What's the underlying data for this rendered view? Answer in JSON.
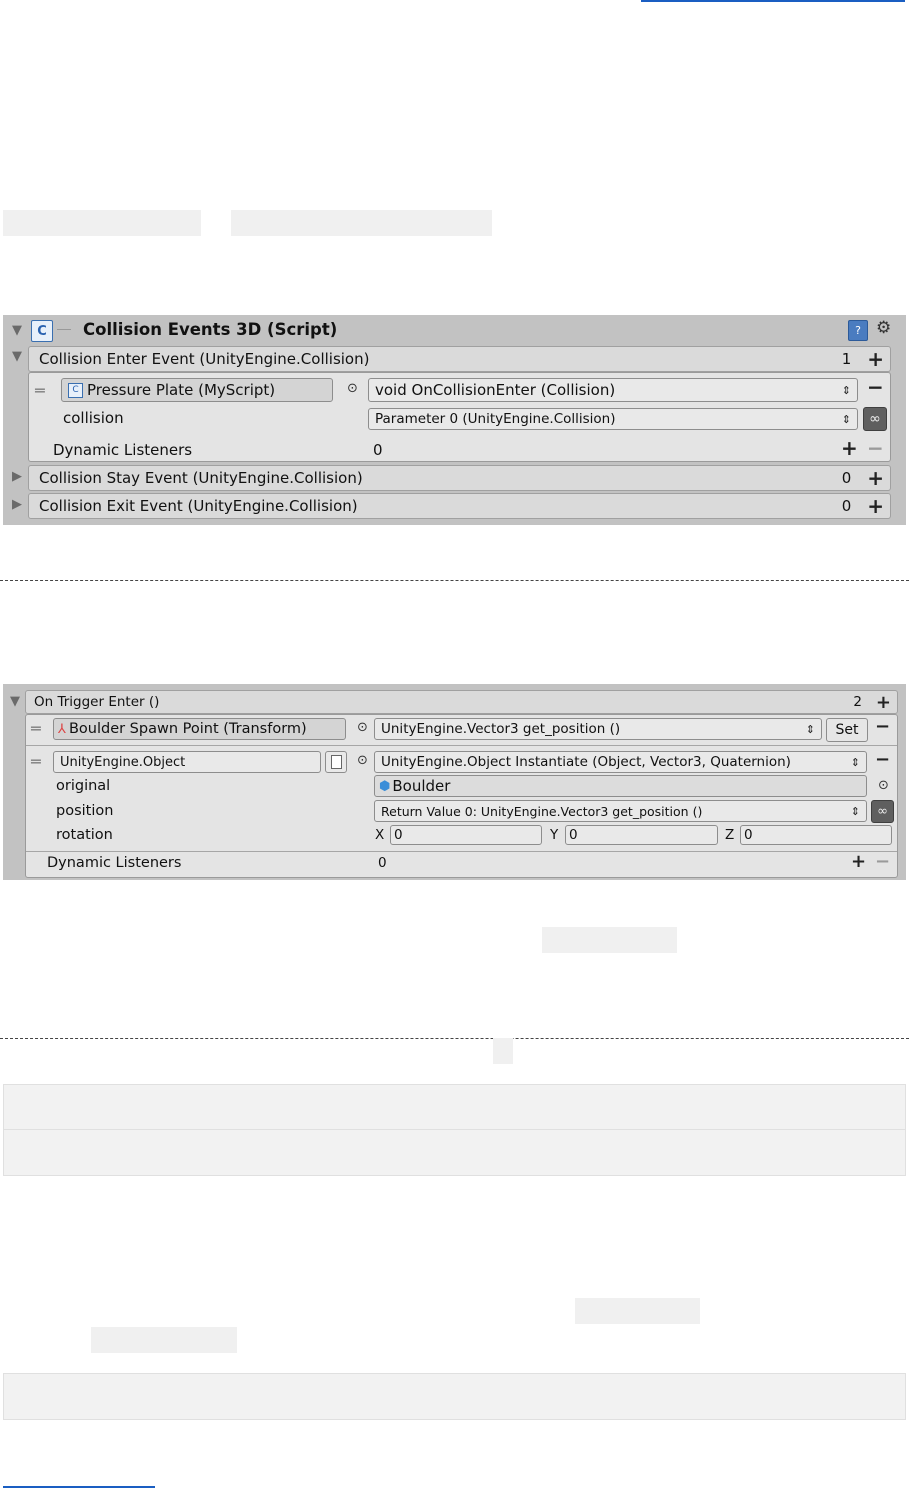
{
  "panel1": {
    "title": "Collision Events 3D (Script)",
    "enter_event": {
      "label": "Collision Enter Event (UnityEngine.Collision)",
      "count": "1"
    },
    "row": {
      "target": "Pressure Plate (MyScript)",
      "function": "void OnCollisionEnter (Collision)",
      "param_label": "collision",
      "param_value": "Parameter 0 (UnityEngine.Collision)"
    },
    "dynamic": {
      "label": "Dynamic Listeners",
      "count": "0"
    },
    "stay_event": {
      "label": "Collision Stay Event (UnityEngine.Collision)",
      "count": "0"
    },
    "exit_event": {
      "label": "Collision Exit Event (UnityEngine.Collision)",
      "count": "0"
    }
  },
  "panel2": {
    "header": {
      "label": "On Trigger Enter ()",
      "count": "2"
    },
    "row1": {
      "target": "Boulder Spawn Point (Transform)",
      "function": "UnityEngine.Vector3 get_position ()",
      "set_label": "Set"
    },
    "row2": {
      "target": "UnityEngine.Object",
      "function": "UnityEngine.Object Instantiate (Object, Vector3, Quaternion)",
      "original_label": "original",
      "original_value": "Boulder",
      "position_label": "position",
      "position_value": "Return Value 0: UnityEngine.Vector3 get_position ()",
      "rotation_label": "rotation",
      "x_label": "X",
      "x_value": "0",
      "y_label": "Y",
      "y_value": "0",
      "z_label": "Z",
      "z_value": "0"
    },
    "dynamic": {
      "label": "Dynamic Listeners",
      "count": "0"
    }
  },
  "symbols": {
    "plus": "+",
    "minus": "−",
    "dropdown": "⇕",
    "infinity": "∞",
    "object_dot": "⊙",
    "collapse": "▼",
    "expand": "▶",
    "grip": "═"
  },
  "icons": [
    "csharp-script-icon",
    "help-book-icon",
    "gear-icon",
    "transform-axis-icon",
    "cube-icon",
    "document-icon"
  ]
}
